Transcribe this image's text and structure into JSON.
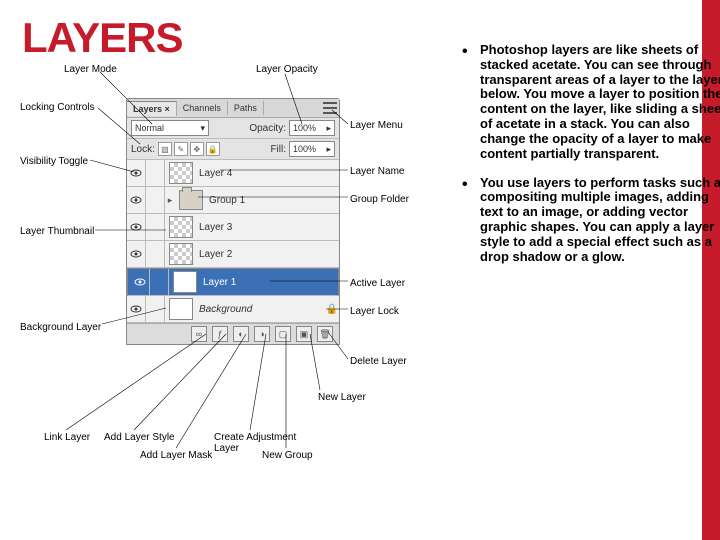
{
  "title": "LAYERS",
  "bullets": [
    "Photoshop layers are like sheets of stacked acetate. You can see through transparent areas of a layer to the layers below. You move a layer to position the content on the layer, like sliding a sheet of acetate in a stack. You can also change the opacity of a layer to make content partially transparent.",
    "You use layers to perform tasks such as compositing multiple images, adding text to an image, or adding vector graphic shapes. You can apply a layer style to add a special effect such as a drop shadow or a glow."
  ],
  "callouts": {
    "layer_mode": "Layer Mode",
    "layer_opacity": "Layer Opacity",
    "locking_controls": "Locking Controls",
    "visibility_toggle": "Visibility Toggle",
    "layer_thumbnail": "Layer Thumbnail",
    "background_layer": "Background Layer",
    "link_layer": "Link Layer",
    "add_layer_style": "Add Layer Style",
    "add_layer_mask": "Add Layer Mask",
    "create_adjustment_layer": "Create Adjustment\nLayer",
    "new_group": "New Group",
    "new_layer": "New Layer",
    "delete_layer": "Delete Layer",
    "layer_menu": "Layer Menu",
    "layer_name": "Layer Name",
    "group_folder": "Group Folder",
    "active_layer": "Active Layer",
    "layer_lock": "Layer Lock"
  },
  "panel": {
    "tabs": [
      "Layers",
      "Channels",
      "Paths"
    ],
    "active_tab": "Layers",
    "mode": "Normal",
    "opacity_label": "Opacity:",
    "opacity_value": "100%",
    "lock_label": "Lock:",
    "fill_label": "Fill:",
    "fill_value": "100%",
    "layers": [
      {
        "name": "Layer 4",
        "type": "layer",
        "thumb": "checker"
      },
      {
        "name": "Group 1",
        "type": "group"
      },
      {
        "name": "Layer 3",
        "type": "layer",
        "thumb": "checker"
      },
      {
        "name": "Layer 2",
        "type": "layer",
        "thumb": "checker"
      },
      {
        "name": "Layer 1",
        "type": "layer",
        "thumb": "white",
        "selected": true
      },
      {
        "name": "Background",
        "type": "bg",
        "thumb": "white",
        "locked": true
      }
    ]
  }
}
